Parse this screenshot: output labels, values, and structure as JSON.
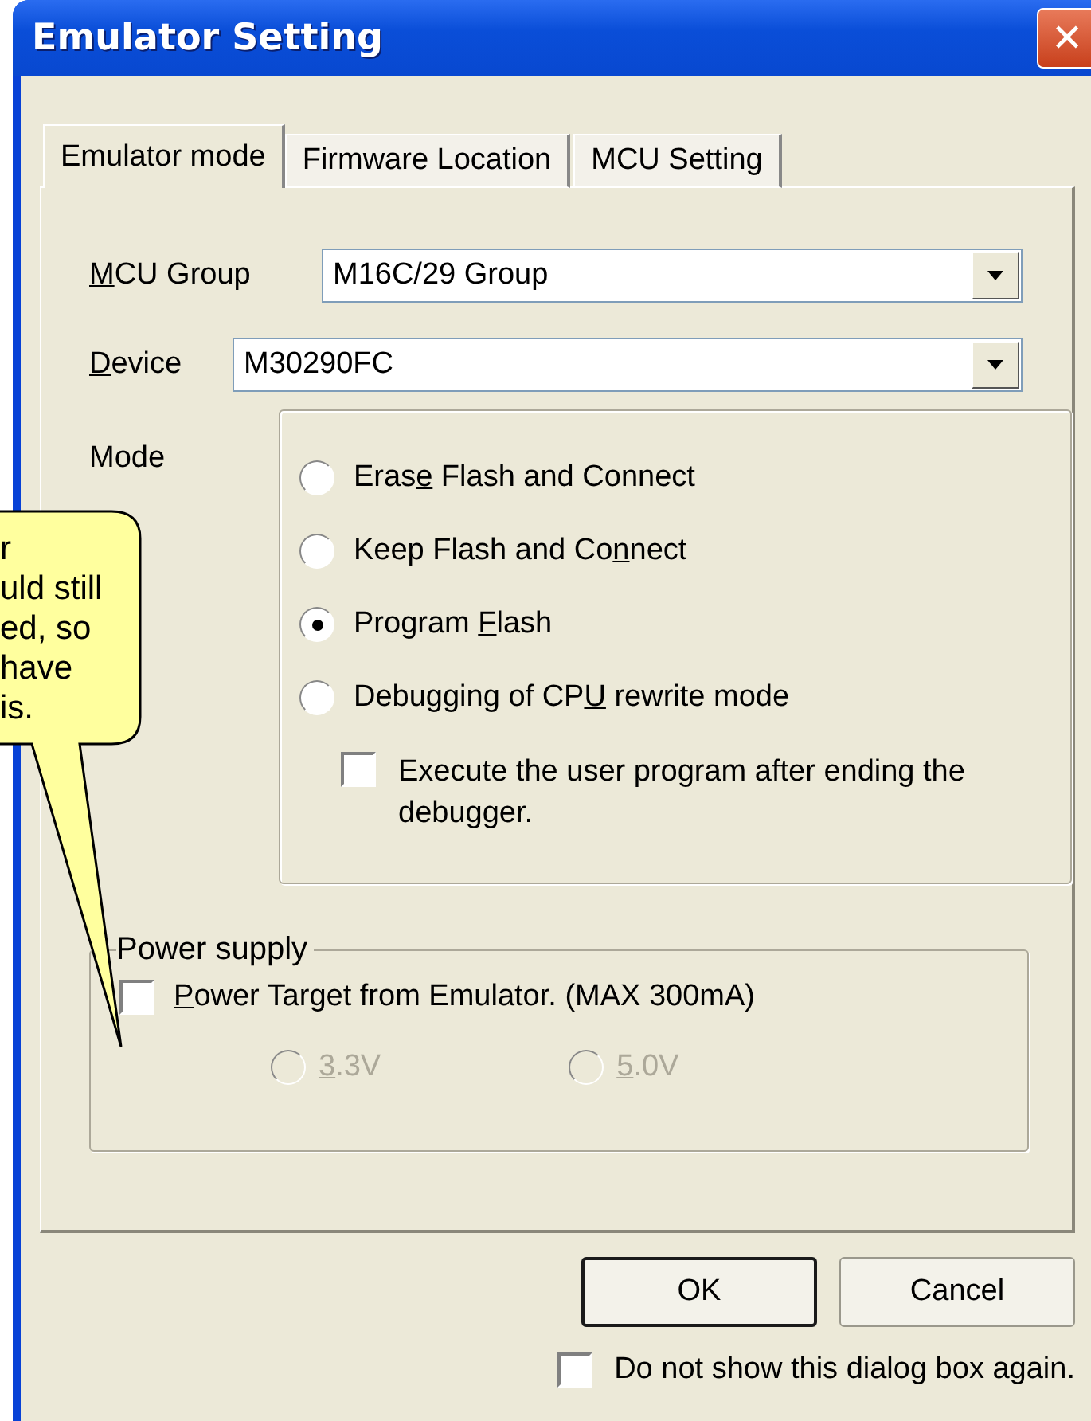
{
  "window": {
    "title": "Emulator Setting",
    "close": "✕"
  },
  "tabs": [
    {
      "label": "Emulator mode",
      "selected": true
    },
    {
      "label": "Firmware Location",
      "selected": false
    },
    {
      "label": "MCU Setting",
      "selected": false
    }
  ],
  "mcu_group": {
    "label": {
      "key": "M",
      "post": "CU Group"
    },
    "value": "M16C/29 Group"
  },
  "device": {
    "label": {
      "key": "D",
      "post": "evice"
    },
    "value": "M30290FC"
  },
  "mode": {
    "label": "Mode",
    "options": [
      {
        "label": {
          "pre": "Eras",
          "key": "e",
          "post": " Flash and Connect"
        },
        "selected": false
      },
      {
        "label": {
          "pre": "Keep Flash and Co",
          "key": "n",
          "post": "nect"
        },
        "selected": false
      },
      {
        "label": {
          "pre": "Program ",
          "key": "F",
          "post": "lash"
        },
        "selected": true
      },
      {
        "label": {
          "pre": "Debugging of CP",
          "key": "U",
          "post": " rewrite mode"
        },
        "selected": false
      }
    ],
    "execute_after": {
      "label": "Execute the user program after ending the debugger.",
      "checked": false
    }
  },
  "power_supply": {
    "title": "Power supply",
    "power_target": {
      "label": {
        "key": "P",
        "post": "ower Target from Emulator. (MAX 300mA)"
      },
      "checked": false
    },
    "voltages": [
      {
        "label": {
          "key": "3",
          "post": ".3V"
        },
        "selected": false,
        "disabled": true
      },
      {
        "label": {
          "key": "5",
          "post": ".0V"
        },
        "selected": false,
        "disabled": true
      }
    ]
  },
  "buttons": [
    {
      "label": "OK",
      "default": true
    },
    {
      "label": "Cancel",
      "default": false
    }
  ],
  "dont_show_again": {
    "label": "Do not show this dialog box again.",
    "checked": false
  },
  "callout": {
    "lines": [
      "r",
      "uld still",
      "ed, so",
      "have",
      "is."
    ]
  }
}
